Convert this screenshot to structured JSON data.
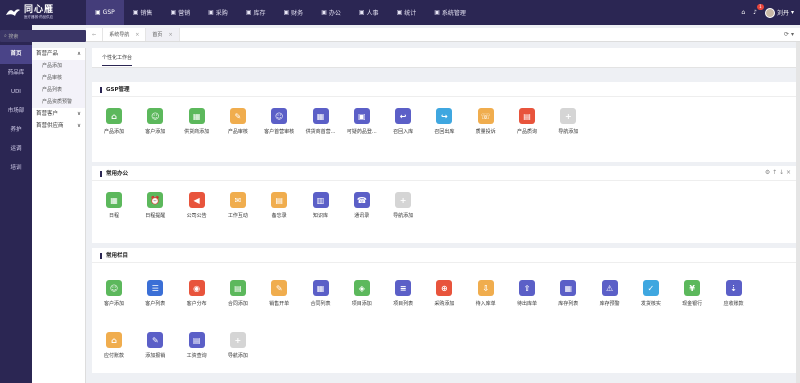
{
  "app": {
    "title": "同心雁",
    "subtitle": "医疗器械·药品供应"
  },
  "topnav": [
    {
      "label": "GSP",
      "icon": "gsp-icon",
      "active": true
    },
    {
      "label": "销售",
      "icon": "sales-icon"
    },
    {
      "label": "营销",
      "icon": "marketing-icon"
    },
    {
      "label": "采购",
      "icon": "purchase-icon"
    },
    {
      "label": "库存",
      "icon": "inventory-icon"
    },
    {
      "label": "财务",
      "icon": "finance-icon"
    },
    {
      "label": "办公",
      "icon": "office-icon"
    },
    {
      "label": "人事",
      "icon": "hr-icon"
    },
    {
      "label": "统计",
      "icon": "stats-icon"
    },
    {
      "label": "系统管理",
      "icon": "system-icon"
    }
  ],
  "topright": {
    "notif_count": "1",
    "user": "刘丹"
  },
  "search": {
    "placeholder": "搜索"
  },
  "side1": [
    "首页",
    "药品库",
    "UDI",
    "市场部",
    "养护",
    "运调",
    "培训"
  ],
  "side2": [
    {
      "label": "首营产品",
      "type": "grp",
      "caret": "∧"
    },
    {
      "label": "产品添加",
      "type": "sub"
    },
    {
      "label": "产品审核",
      "type": "sub"
    },
    {
      "label": "产品列表",
      "type": "sub"
    },
    {
      "label": "产品资质预警",
      "type": "sub"
    },
    {
      "label": "首营客户",
      "type": "grp",
      "caret": "∨"
    },
    {
      "label": "首营供应商",
      "type": "grp",
      "caret": "∨"
    }
  ],
  "tabs": [
    {
      "label": "系统导航",
      "closable": true
    },
    {
      "label": "首页",
      "closable": true
    }
  ],
  "subtab": "个性化工作台",
  "panels": [
    {
      "title": "GSP管理",
      "items": [
        {
          "label": "产品添加",
          "color": "#5cb85c",
          "icon": "⌂"
        },
        {
          "label": "客户添加",
          "color": "#5cb85c",
          "icon": "☺"
        },
        {
          "label": "供货商添加",
          "color": "#5cb85c",
          "icon": "▦"
        },
        {
          "label": "产品审核",
          "color": "#f0ad4e",
          "icon": "✎"
        },
        {
          "label": "客户首营审核",
          "color": "#5b5fc7",
          "icon": "☺"
        },
        {
          "label": "供货商首营...",
          "color": "#5b5fc7",
          "icon": "▦"
        },
        {
          "label": "可疑药品登...",
          "color": "#5b5fc7",
          "icon": "▣"
        },
        {
          "label": "召回入库",
          "color": "#5b5fc7",
          "icon": "↩"
        },
        {
          "label": "召回出库",
          "color": "#3fa7e0",
          "icon": "↪"
        },
        {
          "label": "质量投诉",
          "color": "#f0ad4e",
          "icon": "☏"
        },
        {
          "label": "产品质询",
          "color": "#e8543c",
          "icon": "▤"
        },
        {
          "label": "导航添加",
          "color": "#d5d5d5",
          "icon": "+"
        }
      ]
    },
    {
      "title": "常用办公",
      "items": [
        {
          "label": "日程",
          "color": "#5cb85c",
          "icon": "▦"
        },
        {
          "label": "日程提醒",
          "color": "#5cb85c",
          "icon": "⏰"
        },
        {
          "label": "公司公告",
          "color": "#e8543c",
          "icon": "◀"
        },
        {
          "label": "工作互动",
          "color": "#f0ad4e",
          "icon": "✉"
        },
        {
          "label": "备忘录",
          "color": "#f0ad4e",
          "icon": "▤"
        },
        {
          "label": "知识库",
          "color": "#5b5fc7",
          "icon": "▥"
        },
        {
          "label": "通讯录",
          "color": "#5b5fc7",
          "icon": "☎"
        },
        {
          "label": "导航添加",
          "color": "#d5d5d5",
          "icon": "+"
        }
      ]
    },
    {
      "title": "常用栏目",
      "items": [
        {
          "label": "客户添加",
          "color": "#5cb85c",
          "icon": "☺"
        },
        {
          "label": "客户列表",
          "color": "#3b6fd6",
          "icon": "☰"
        },
        {
          "label": "客户分布",
          "color": "#e8543c",
          "icon": "◉"
        },
        {
          "label": "合同添加",
          "color": "#5cb85c",
          "icon": "▤"
        },
        {
          "label": "销售开单",
          "color": "#f0ad4e",
          "icon": "✎"
        },
        {
          "label": "合同列表",
          "color": "#5b5fc7",
          "icon": "▦"
        },
        {
          "label": "项目添加",
          "color": "#5cb85c",
          "icon": "◈"
        },
        {
          "label": "项目列表",
          "color": "#5b5fc7",
          "icon": "≡"
        },
        {
          "label": "采购添加",
          "color": "#e8543c",
          "icon": "⊕"
        },
        {
          "label": "待入库单",
          "color": "#f0ad4e",
          "icon": "⇩"
        },
        {
          "label": "待出库单",
          "color": "#5b5fc7",
          "icon": "⇧"
        },
        {
          "label": "库存列表",
          "color": "#5b5fc7",
          "icon": "▦"
        },
        {
          "label": "库存预警",
          "color": "#5b5fc7",
          "icon": "⚠"
        },
        {
          "label": "发货核实",
          "color": "#3fa7e0",
          "icon": "✓"
        },
        {
          "label": "现金银行",
          "color": "#5cb85c",
          "icon": "¥"
        },
        {
          "label": "应收账款",
          "color": "#5b5fc7",
          "icon": "⇣"
        },
        {
          "label": "应付账款",
          "color": "#f0ad4e",
          "icon": "⌂"
        },
        {
          "label": "添加报销",
          "color": "#5b5fc7",
          "icon": "✎"
        },
        {
          "label": "工资查询",
          "color": "#5b5fc7",
          "icon": "▤"
        },
        {
          "label": "导航添加",
          "color": "#d5d5d5",
          "icon": "+"
        }
      ]
    }
  ]
}
